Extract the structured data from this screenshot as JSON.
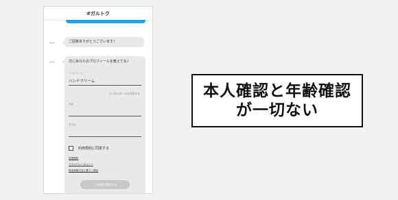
{
  "chat": {
    "title": "#ガルトク",
    "info_label_1": "INFO",
    "message_1": "ご回答ありがとうございます！",
    "info_label_2": "INFO",
    "message_2": "次にあなたのプロフィールを教えてね♪"
  },
  "form": {
    "nickname_label": "ニックネーム",
    "nickname_value": "ハンドクリーム",
    "random_name_link": "ランダムネームを利用する",
    "age_label": "年齢",
    "location_label": "居住地",
    "agree_label": "利用規約に同意する",
    "terms_link": "利用規約",
    "privacy_link": "プライバシーポリシー",
    "law_link": "特定商取引法に基づく表記",
    "submit_label": "この内容で登録する"
  },
  "caption": {
    "line1": "本人確認と年齢確認",
    "line2": "が一切ない"
  },
  "colors": {
    "accent_blue": "#1da1f2",
    "bubble_gray": "#e9e9e9",
    "button_gray": "#c8c8c8"
  }
}
